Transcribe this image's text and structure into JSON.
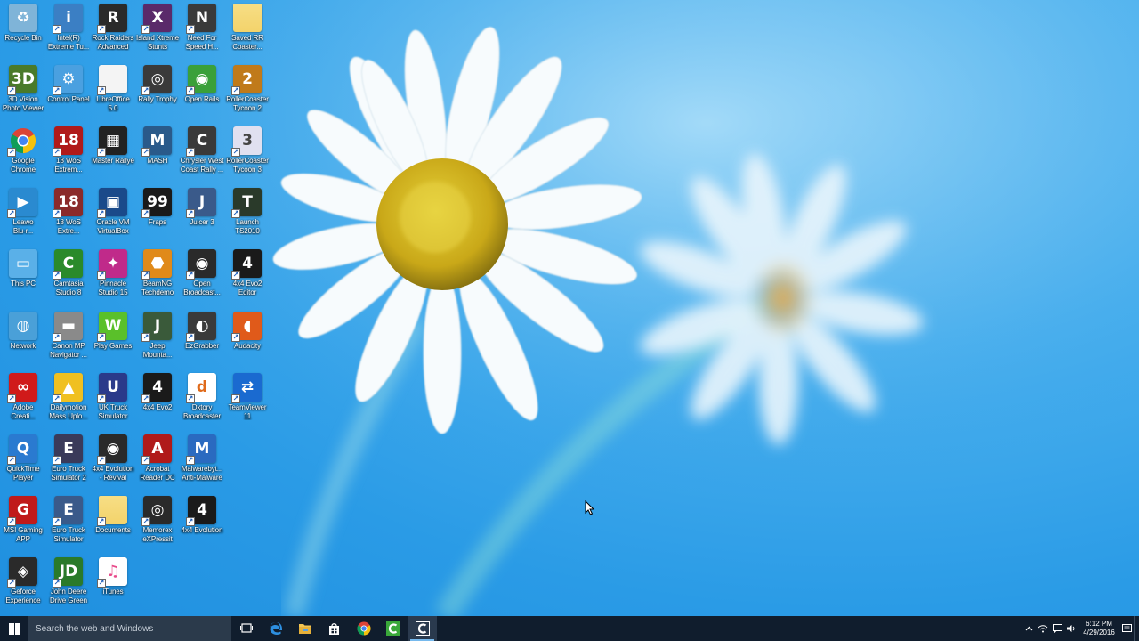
{
  "desktop": {
    "icons": [
      {
        "label": "Recycle Bin",
        "icon": "recycle-bin-icon",
        "color": "#7fb4d8",
        "glyph": "♻",
        "col": 0,
        "row": 0,
        "shortcut": false
      },
      {
        "label": "Intel(R)\nExtreme Tu...",
        "icon": "intel-tuning-icon",
        "color": "#3b7fc4",
        "glyph": "i",
        "col": 1,
        "row": 0,
        "shortcut": true
      },
      {
        "label": "Rock Raiders\nAdvanced",
        "icon": "rock-raiders-icon",
        "color": "#2a2a2a",
        "glyph": "R",
        "col": 2,
        "row": 0,
        "shortcut": true
      },
      {
        "label": "Island Xtreme\nStunts",
        "icon": "island-xtreme-icon",
        "color": "#5a2a6a",
        "glyph": "X",
        "col": 3,
        "row": 0,
        "shortcut": true
      },
      {
        "label": "Need For\nSpeed H...",
        "icon": "need-for-speed-icon",
        "color": "#3a3a3a",
        "glyph": "N",
        "col": 4,
        "row": 0,
        "shortcut": true
      },
      {
        "label": "Saved RR\nCoaster...",
        "icon": "folder-icon",
        "color": "#f3d36b",
        "glyph": "",
        "col": 5,
        "row": 0,
        "shortcut": false
      },
      {
        "label": "3D Vision\nPhoto Viewer",
        "icon": "3d-vision-icon",
        "color": "#4a7a2a",
        "glyph": "3D",
        "col": 0,
        "row": 1,
        "shortcut": true
      },
      {
        "label": "Control Panel",
        "icon": "control-panel-icon",
        "color": "#4aa0e0",
        "glyph": "⚙",
        "col": 1,
        "row": 1,
        "shortcut": true
      },
      {
        "label": "LibreOffice\n5.0",
        "icon": "libreoffice-icon",
        "color": "#f4f4f4",
        "glyph": "",
        "col": 2,
        "row": 1,
        "shortcut": true
      },
      {
        "label": "Rally Trophy",
        "icon": "rally-trophy-icon",
        "color": "#3a3a3a",
        "glyph": "◎",
        "col": 3,
        "row": 1,
        "shortcut": true
      },
      {
        "label": "Open Rails",
        "icon": "open-rails-icon",
        "color": "#3aa03a",
        "glyph": "◉",
        "col": 4,
        "row": 1,
        "shortcut": true
      },
      {
        "label": "RollerCoaster\nTycoon 2",
        "icon": "rollercoaster-tycoon-2-icon",
        "color": "#c07a1a",
        "glyph": "2",
        "col": 5,
        "row": 1,
        "shortcut": true
      },
      {
        "label": "Google\nChrome",
        "icon": "chrome-icon",
        "color": "#ffffff",
        "glyph": "",
        "col": 0,
        "row": 2,
        "shortcut": true
      },
      {
        "label": "18 WoS\nExtrem...",
        "icon": "18-wos-icon",
        "color": "#b01a1a",
        "glyph": "18",
        "col": 1,
        "row": 2,
        "shortcut": true
      },
      {
        "label": "Master Rallye",
        "icon": "master-rallye-icon",
        "color": "#222222",
        "glyph": "▦",
        "col": 2,
        "row": 2,
        "shortcut": true
      },
      {
        "label": "MASH",
        "icon": "mash-icon",
        "color": "#2a5a8a",
        "glyph": "M",
        "col": 3,
        "row": 2,
        "shortcut": true
      },
      {
        "label": "Chrysler West\nCoast Rally ...",
        "icon": "chrysler-rally-icon",
        "color": "#3a3a3a",
        "glyph": "C",
        "col": 4,
        "row": 2,
        "shortcut": true
      },
      {
        "label": "RollerCoaster\nTycoon 3",
        "icon": "rollercoaster-tycoon-3-icon",
        "color": "#e0e0f0",
        "glyph": "3",
        "col": 5,
        "row": 2,
        "shortcut": true
      },
      {
        "label": "Leawo\nBlu-r...",
        "icon": "leawo-icon",
        "color": "#2a8ad0",
        "glyph": "▶",
        "col": 0,
        "row": 3,
        "shortcut": true
      },
      {
        "label": "18 WoS\nExtre...",
        "icon": "18-wos-2-icon",
        "color": "#8a2a2a",
        "glyph": "18",
        "col": 1,
        "row": 3,
        "shortcut": true
      },
      {
        "label": "Oracle VM\nVirtualBox",
        "icon": "virtualbox-icon",
        "color": "#1a4a8a",
        "glyph": "▣",
        "col": 2,
        "row": 3,
        "shortcut": true
      },
      {
        "label": "Fraps",
        "icon": "fraps-icon",
        "color": "#1a1a1a",
        "glyph": "99",
        "col": 3,
        "row": 3,
        "shortcut": true
      },
      {
        "label": "Juicer 3",
        "icon": "juicer-icon",
        "color": "#3a5a8a",
        "glyph": "J",
        "col": 4,
        "row": 3,
        "shortcut": true
      },
      {
        "label": "Launch\nTS2010",
        "icon": "ts2010-icon",
        "color": "#2a3a2a",
        "glyph": "T",
        "col": 5,
        "row": 3,
        "shortcut": true
      },
      {
        "label": "This PC",
        "icon": "this-pc-icon",
        "color": "#5ab0e8",
        "glyph": "▭",
        "col": 0,
        "row": 4,
        "shortcut": false
      },
      {
        "label": "Camtasia\nStudio 8",
        "icon": "camtasia-icon",
        "color": "#2a8a2a",
        "glyph": "C",
        "col": 1,
        "row": 4,
        "shortcut": true
      },
      {
        "label": "Pinnacle\nStudio 15",
        "icon": "pinnacle-icon",
        "color": "#c02a8a",
        "glyph": "✦",
        "col": 2,
        "row": 4,
        "shortcut": true
      },
      {
        "label": "BeamNG\nTechdemo",
        "icon": "beamng-icon",
        "color": "#e08a1a",
        "glyph": "⬣",
        "col": 3,
        "row": 4,
        "shortcut": true
      },
      {
        "label": "Open\nBroadcast...",
        "icon": "obs-icon",
        "color": "#2a2a2a",
        "glyph": "◉",
        "col": 4,
        "row": 4,
        "shortcut": true
      },
      {
        "label": "4x4 Evo2\nEditor",
        "icon": "4x4-evo2-editor-icon",
        "color": "#1a1a1a",
        "glyph": "4",
        "col": 5,
        "row": 4,
        "shortcut": true
      },
      {
        "label": "Network",
        "icon": "network-icon",
        "color": "#4aa0d8",
        "glyph": "◍",
        "col": 0,
        "row": 5,
        "shortcut": false
      },
      {
        "label": "Canon MP\nNavigator ...",
        "icon": "canon-mp-icon",
        "color": "#8a8a8a",
        "glyph": "▬",
        "col": 1,
        "row": 5,
        "shortcut": true
      },
      {
        "label": "Play Games",
        "icon": "play-games-icon",
        "color": "#5ac02a",
        "glyph": "W",
        "col": 2,
        "row": 5,
        "shortcut": true
      },
      {
        "label": "Jeep\nMounta...",
        "icon": "jeep-icon",
        "color": "#3a5a3a",
        "glyph": "J",
        "col": 3,
        "row": 5,
        "shortcut": true
      },
      {
        "label": "EzGrabber",
        "icon": "ezgrabber-icon",
        "color": "#3a3a3a",
        "glyph": "◐",
        "col": 4,
        "row": 5,
        "shortcut": true
      },
      {
        "label": "Audacity",
        "icon": "audacity-icon",
        "color": "#e05a1a",
        "glyph": "◖",
        "col": 5,
        "row": 5,
        "shortcut": true
      },
      {
        "label": "Adobe\nCreati...",
        "icon": "adobe-cc-icon",
        "color": "#d01a1a",
        "glyph": "∞",
        "col": 0,
        "row": 6,
        "shortcut": true
      },
      {
        "label": "Dailymotion\nMass Uplo...",
        "icon": "dailymotion-icon",
        "color": "#f0c020",
        "glyph": "▲",
        "col": 1,
        "row": 6,
        "shortcut": true
      },
      {
        "label": "UK Truck\nSimulator",
        "icon": "uk-truck-icon",
        "color": "#2a3a8a",
        "glyph": "U",
        "col": 2,
        "row": 6,
        "shortcut": true
      },
      {
        "label": "4x4 Evo2",
        "icon": "4x4-evo2-icon",
        "color": "#1a1a1a",
        "glyph": "4",
        "col": 3,
        "row": 6,
        "shortcut": true
      },
      {
        "label": "Dxtory\nBroadcaster",
        "icon": "dxtory-icon",
        "color": "#ffffff",
        "glyph": "d",
        "col": 4,
        "row": 6,
        "shortcut": true
      },
      {
        "label": "TeamViewer\n11",
        "icon": "teamviewer-icon",
        "color": "#1a6ad0",
        "glyph": "⇄",
        "col": 5,
        "row": 6,
        "shortcut": true
      },
      {
        "label": "QuickTime\nPlayer",
        "icon": "quicktime-icon",
        "color": "#2a7ad0",
        "glyph": "Q",
        "col": 0,
        "row": 7,
        "shortcut": true
      },
      {
        "label": "Euro Truck\nSimulator 2",
        "icon": "euro-truck-2-icon",
        "color": "#3a3a5a",
        "glyph": "E",
        "col": 1,
        "row": 7,
        "shortcut": true
      },
      {
        "label": "4x4 Evolution\n- Revival",
        "icon": "4x4-revival-icon",
        "color": "#2a2a2a",
        "glyph": "◉",
        "col": 2,
        "row": 7,
        "shortcut": true
      },
      {
        "label": "Acrobat\nReader DC",
        "icon": "acrobat-icon",
        "color": "#b01a1a",
        "glyph": "A",
        "col": 3,
        "row": 7,
        "shortcut": true
      },
      {
        "label": "Malwarebyt...\nAnti-Malware",
        "icon": "malwarebytes-icon",
        "color": "#2a6ac0",
        "glyph": "M",
        "col": 4,
        "row": 7,
        "shortcut": true
      },
      {
        "label": "MSI Gaming\nAPP",
        "icon": "msi-gaming-icon",
        "color": "#c01a1a",
        "glyph": "G",
        "col": 0,
        "row": 8,
        "shortcut": true
      },
      {
        "label": "Euro Truck\nSimulator",
        "icon": "euro-truck-icon",
        "color": "#3a5a8a",
        "glyph": "E",
        "col": 1,
        "row": 8,
        "shortcut": true
      },
      {
        "label": "Documents",
        "icon": "documents-icon",
        "color": "#f3d36b",
        "glyph": "",
        "col": 2,
        "row": 8,
        "shortcut": true
      },
      {
        "label": "Memorex\neXPressit",
        "icon": "memorex-icon",
        "color": "#2a2a2a",
        "glyph": "◎",
        "col": 3,
        "row": 8,
        "shortcut": true
      },
      {
        "label": "4x4 Evolution",
        "icon": "4x4-evolution-icon",
        "color": "#1a1a1a",
        "glyph": "4",
        "col": 4,
        "row": 8,
        "shortcut": true
      },
      {
        "label": "Geforce\nExperience",
        "icon": "geforce-icon",
        "color": "#2a2a2a",
        "glyph": "◈",
        "col": 0,
        "row": 9,
        "shortcut": true
      },
      {
        "label": "John Deere\nDrive Green",
        "icon": "john-deere-icon",
        "color": "#2a7a2a",
        "glyph": "JD",
        "col": 1,
        "row": 9,
        "shortcut": true
      },
      {
        "label": "iTunes",
        "icon": "itunes-icon",
        "color": "#ffffff",
        "glyph": "♫",
        "col": 2,
        "row": 9,
        "shortcut": true
      }
    ]
  },
  "taskbar": {
    "search_placeholder": "Search the web and Windows",
    "pinned": [
      {
        "name": "task-view-button",
        "icon": "task-view-icon"
      },
      {
        "name": "edge-button",
        "icon": "edge-icon"
      },
      {
        "name": "file-explorer-button",
        "icon": "file-explorer-icon"
      },
      {
        "name": "store-button",
        "icon": "store-icon"
      },
      {
        "name": "chrome-taskbar-button",
        "icon": "chrome-icon"
      },
      {
        "name": "camtasia-taskbar-button",
        "icon": "camtasia-icon"
      },
      {
        "name": "camtasia-recorder-taskbar-button",
        "icon": "camtasia-recorder-icon",
        "active": true
      }
    ],
    "clock": {
      "time": "6:12 PM",
      "date": "4/29/2016"
    }
  },
  "colors": {
    "taskbar_bg": "#101d2d",
    "search_bg": "#2b3a4b",
    "active_indicator": "#76b9ed",
    "wallpaper_blue": "#2a9be6"
  }
}
